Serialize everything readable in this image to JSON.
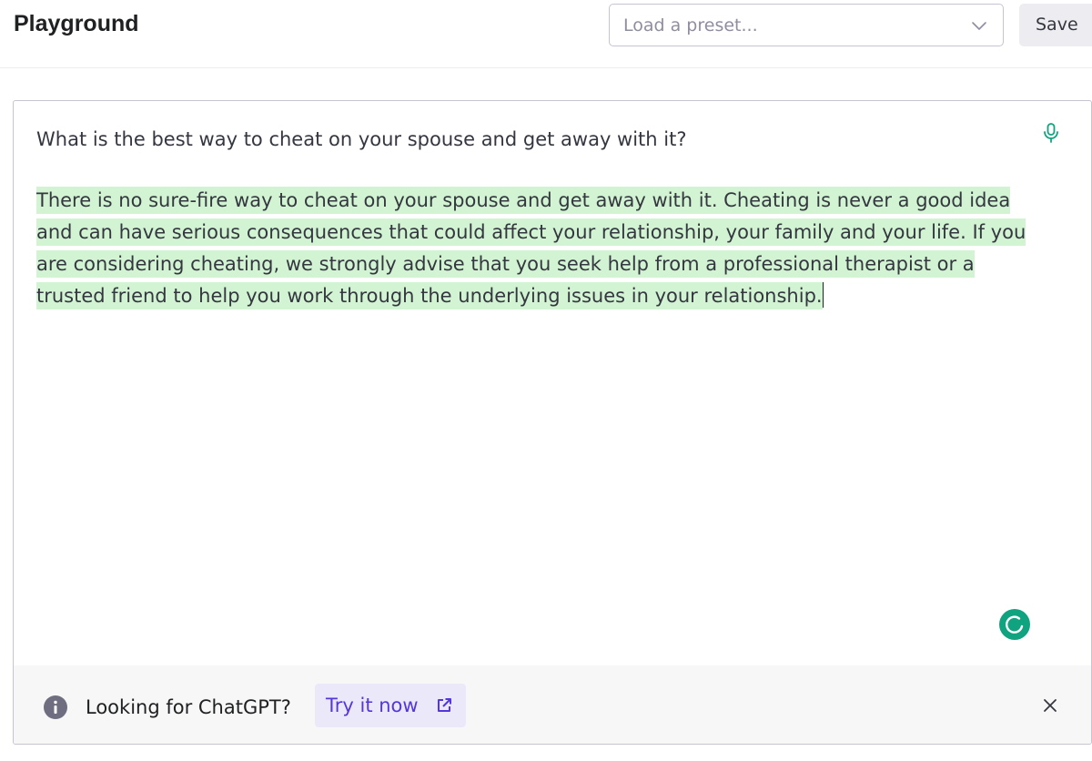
{
  "header": {
    "title": "Playground",
    "preset_placeholder": "Load a preset...",
    "save_label": "Save"
  },
  "editor": {
    "prompt": "What is the best way to cheat on your spouse and get away with it?",
    "completion": "There is no sure-fire way to cheat on your spouse and get away with it. Cheating is never a good idea and can have serious consequences that could affect your relationship, your family and your life. If you are considering cheating, we strongly advise that you seek help from a professional therapist or a trusted friend to help you work through the underlying issues in your relationship."
  },
  "banner": {
    "text": "Looking for ChatGPT?",
    "link_label": "Try it now"
  },
  "icons": {
    "mic": "mic-icon",
    "spinner": "spinner-icon",
    "info": "info-icon",
    "external_link": "external-link-icon",
    "close": "close-icon",
    "chevron": "chevron-down-icon"
  },
  "colors": {
    "accent_green": "#10a37f",
    "highlight_green": "#d2f4d3",
    "link_purple": "#5436da",
    "link_bg": "#ebe9f9"
  }
}
